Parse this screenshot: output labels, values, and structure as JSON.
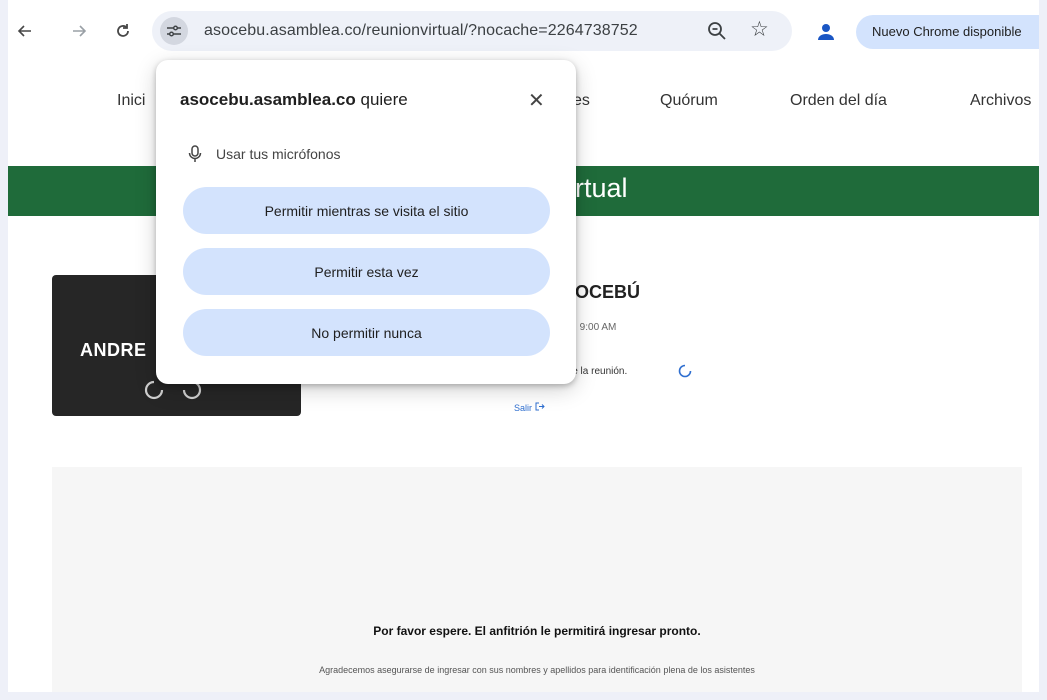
{
  "browser": {
    "url": "asocebu.asamblea.co/reunionvirtual/?nocache=2264738752",
    "update_label": "Nuevo Chrome disponible",
    "back_icon": "arrow-left-icon",
    "forward_icon": "arrow-right-icon",
    "reload_icon": "reload-icon",
    "zoom_icon": "zoom-icon",
    "bookmark_icon": "star-icon",
    "profile_icon": "profile-icon"
  },
  "nav": {
    "inicio": "Inici",
    "partial": "es",
    "quorum": "Quórum",
    "orden": "Orden del día",
    "archivos": "Archivos"
  },
  "banner": {
    "text_visible": "rtual",
    "color": "#1f6b3a"
  },
  "tile": {
    "name_visible": "ANDRE"
  },
  "meeting": {
    "title_visible": "OCEBÚ",
    "date_visible": "25, 9:00 AM",
    "wait_visible": "cie la reunión.",
    "exit_label": "Salir"
  },
  "waiting": {
    "title": "Por favor espere. El anfitrión le permitirá ingresar pronto.",
    "subtitle": "Agradecemos asegurarse de ingresar con sus nombres y apellidos para identificación plena de los asistentes"
  },
  "permission_popup": {
    "site": "asocebu.asamblea.co",
    "request": "quiere",
    "close_icon": "close-icon",
    "permission_label": "Usar tus micrófonos",
    "buttons": {
      "allow_while_visiting": "Permitir mientras se visita el sitio",
      "allow_once": "Permitir esta vez",
      "never_allow": "No permitir nunca"
    },
    "button_color": "#d3e3fd"
  }
}
